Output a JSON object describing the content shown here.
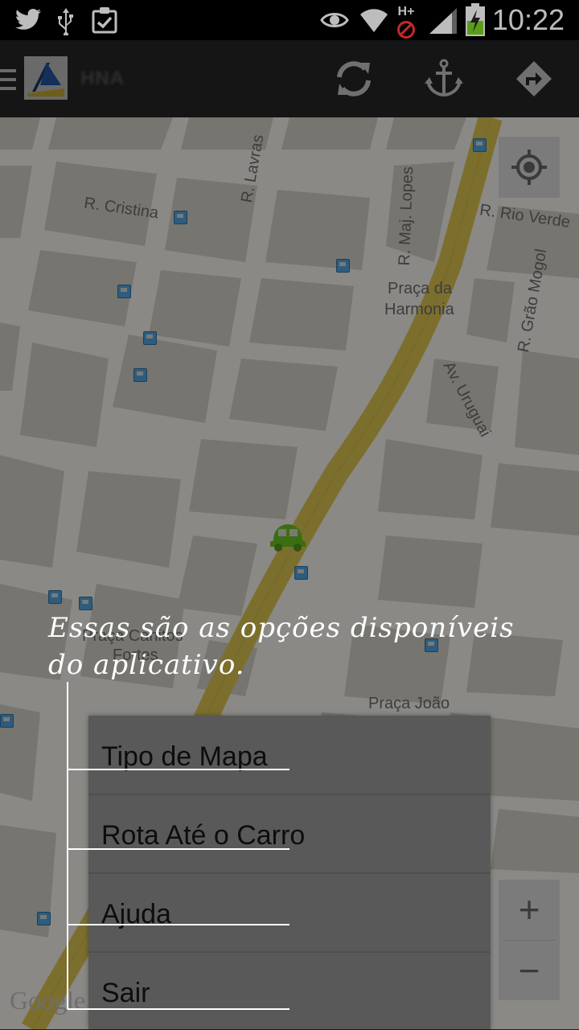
{
  "status_bar": {
    "time": "10:22",
    "network": "H+",
    "icons": [
      "twitter-icon",
      "usb-icon",
      "clipboard-icon",
      "eye-icon",
      "wifi-icon",
      "network-type-icon",
      "signal-icon",
      "battery-charging-icon"
    ]
  },
  "action_bar": {
    "title": "HNA",
    "actions": [
      "refresh-icon",
      "anchor-icon",
      "directions-icon"
    ]
  },
  "map": {
    "labels": {
      "r_lavras": "R. Lavras",
      "r_cristina": "R. Cristina",
      "r_maj_lopes": "R. Maj. Lopes",
      "r_rio_verde": "R. Rio Verde",
      "praca_harmonia_1": "Praça da",
      "praca_harmonia_2": "Harmonia",
      "r_grao_mogol": "R. Grão Mogol",
      "av_uruguai": "Av. Uruguai",
      "praca_canitos_1": "Praça Canitos",
      "praca_canitos_2": "Fortes",
      "praca_joao": "Praça João"
    },
    "zoom_in": "+",
    "zoom_out": "−",
    "attribution": "Google"
  },
  "annotation": {
    "text_line1": "Essas são as opções disponíveis",
    "text_line2": "do aplicativo."
  },
  "menu": {
    "items": [
      "Tipo de Mapa",
      "Rota Até o Carro",
      "Ajuda",
      "Sair"
    ]
  },
  "colors": {
    "map_road": "#8a8986",
    "map_block": "#76756f",
    "main_avenue": "#7c6f2d",
    "car_marker": "#3b6e12",
    "bus_stop": "#2c5d80"
  }
}
